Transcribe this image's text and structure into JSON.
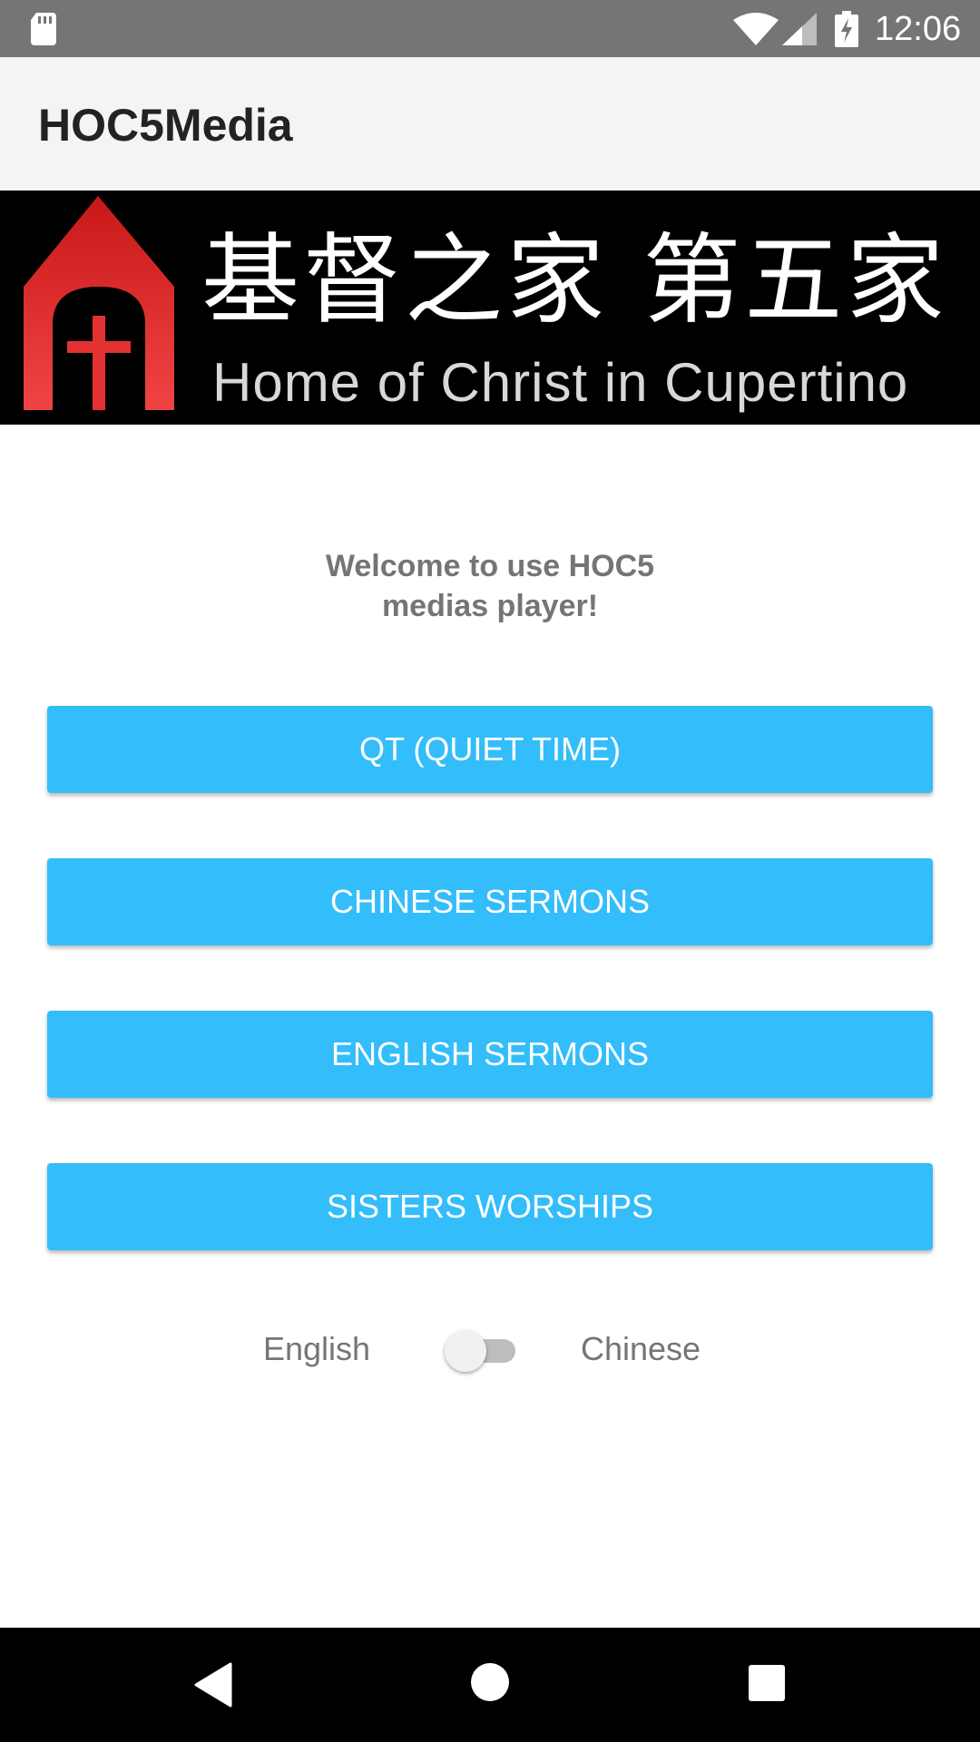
{
  "status_bar": {
    "time": "12:06",
    "icons": [
      "sd-card-icon",
      "wifi-icon",
      "cell-signal-icon",
      "battery-charging-icon"
    ]
  },
  "app_bar": {
    "title": "HOC5Media"
  },
  "banner": {
    "chinese_name": "基督之家 第五家",
    "english_name": "Home of Christ in Cupertino",
    "logo_icon": "church-cross-icon"
  },
  "main": {
    "welcome_line1": "Welcome to use HOC5",
    "welcome_line2": "medias player!",
    "buttons": [
      {
        "label": "QT (QUIET TIME)"
      },
      {
        "label": "CHINESE SERMONS"
      },
      {
        "label": "ENGLISH SERMONS"
      },
      {
        "label": "SISTERS WORSHIPS"
      }
    ],
    "button_color": "#33bdfa",
    "language_toggle": {
      "left_label": "English",
      "right_label": "Chinese",
      "state": "off"
    }
  },
  "nav_bar": {
    "icons": [
      "back-icon",
      "home-icon",
      "recents-icon"
    ]
  }
}
